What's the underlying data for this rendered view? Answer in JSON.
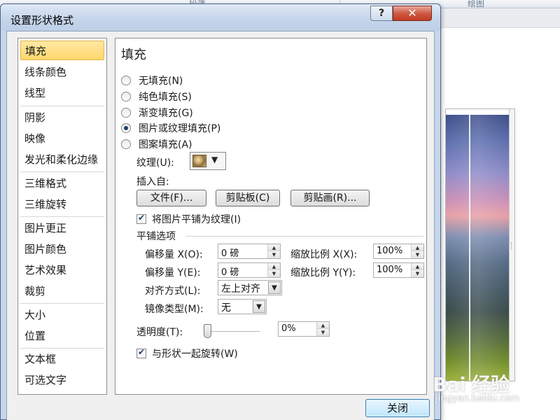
{
  "background": {
    "ribbon_labels": [
      "段落",
      "绘图"
    ],
    "watermark": {
      "brand": "Bai 经验",
      "url": "jingyan.baidu.com"
    }
  },
  "dialog": {
    "title": "设置形状格式",
    "help_glyph": "?",
    "close_glyph": "✕",
    "close_button_label": "关闭"
  },
  "sidebar": {
    "items": [
      {
        "label": "填充",
        "selected": true
      },
      {
        "label": "线条颜色"
      },
      {
        "label": "线型"
      },
      {
        "label": "阴影"
      },
      {
        "label": "映像"
      },
      {
        "label": "发光和柔化边缘"
      },
      {
        "label": "三维格式"
      },
      {
        "label": "三维旋转"
      },
      {
        "label": "图片更正"
      },
      {
        "label": "图片颜色"
      },
      {
        "label": "艺术效果"
      },
      {
        "label": "裁剪"
      },
      {
        "label": "大小"
      },
      {
        "label": "位置"
      },
      {
        "label": "文本框"
      },
      {
        "label": "可选文字"
      }
    ]
  },
  "fill": {
    "heading": "填充",
    "options": [
      {
        "label": "无填充(N)",
        "checked": false
      },
      {
        "label": "纯色填充(S)",
        "checked": false
      },
      {
        "label": "渐变填充(G)",
        "checked": false
      },
      {
        "label": "图片或纹理填充(P)",
        "checked": true
      },
      {
        "label": "图案填充(A)",
        "checked": false
      }
    ],
    "texture_label": "纹理(U):",
    "texture_icon": "texture-swatch-icon",
    "insert_from_label": "插入自:",
    "buttons": {
      "file": "文件(F)...",
      "clipboard": "剪贴板(C)",
      "clipart": "剪贴画(R)..."
    },
    "tile_checkbox": {
      "label": "将图片平铺为纹理(I)",
      "checked": true
    },
    "tiling_heading": "平铺选项",
    "offset_x": {
      "label": "偏移量 X(O):",
      "value": "0 磅"
    },
    "offset_y": {
      "label": "偏移量 Y(E):",
      "value": "0 磅"
    },
    "scale_x": {
      "label": "缩放比例 X(X):",
      "value": "100%"
    },
    "scale_y": {
      "label": "缩放比例 Y(Y):",
      "value": "100%"
    },
    "alignment": {
      "label": "对齐方式(L):",
      "value": "左上对齐"
    },
    "mirror": {
      "label": "镜像类型(M):",
      "value": "无"
    },
    "transparency": {
      "label": "透明度(T):",
      "value": "0%",
      "level": 0
    },
    "rotate_checkbox": {
      "label": "与形状一起旋转(W)",
      "checked": true
    }
  }
}
